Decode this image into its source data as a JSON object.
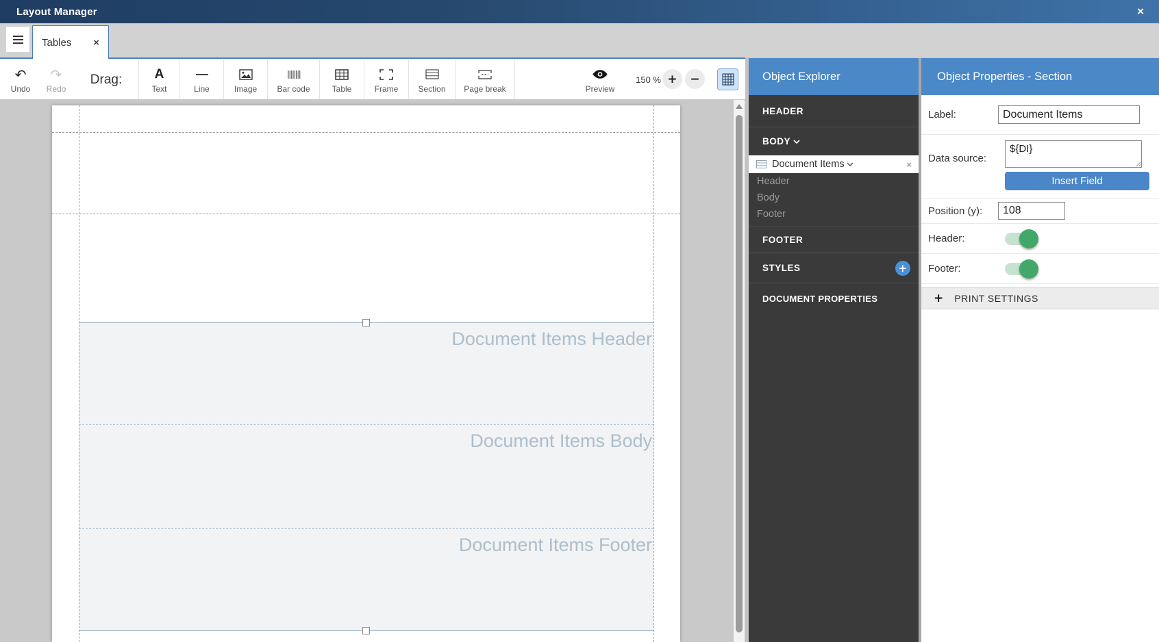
{
  "window": {
    "title": "Layout Manager",
    "close_icon": "×"
  },
  "tabs": {
    "menu_icon": "hamburger",
    "items": [
      {
        "label": "Tables",
        "close_icon": "×",
        "active": true
      }
    ]
  },
  "toolbar": {
    "undo_label": "Undo",
    "redo_label": "Redo",
    "undo_glyph": "↶",
    "redo_glyph": "↷",
    "drag_label": "Drag:",
    "drag_items": [
      {
        "label": "Text",
        "icon": "text-A-icon",
        "glyph": "A"
      },
      {
        "label": "Line",
        "icon": "line-icon"
      },
      {
        "label": "Image",
        "icon": "image-icon"
      },
      {
        "label": "Bar code",
        "icon": "barcode-icon"
      },
      {
        "label": "Table",
        "icon": "table-icon"
      },
      {
        "label": "Frame",
        "icon": "frame-icon"
      },
      {
        "label": "Section",
        "icon": "section-icon"
      },
      {
        "label": "Page break",
        "icon": "page-break-icon"
      }
    ],
    "preview_label": "Preview",
    "preview_icon": "eye-icon",
    "zoom_level": "150 %",
    "zoom_in_glyph": "+",
    "zoom_out_glyph": "−",
    "grid_toggle_icon": "grid-icon"
  },
  "canvas": {
    "sections": [
      {
        "label": "Document Items Header"
      },
      {
        "label": "Document Items Body"
      },
      {
        "label": "Document Items Footer"
      }
    ]
  },
  "object_explorer": {
    "title": "Object Explorer",
    "groups": {
      "header": "HEADER",
      "body": "BODY",
      "footer": "FOOTER",
      "styles": "STYLES",
      "document_properties": "DOCUMENT PROPERTIES"
    },
    "selected_item": {
      "label": "Document Items",
      "icon": "section-rows-icon",
      "delete_icon": "×",
      "children": [
        "Header",
        "Body",
        "Footer"
      ]
    },
    "add_style_glyph": "+"
  },
  "object_properties": {
    "title": "Object Properties - Section",
    "label_field": {
      "name": "Label:",
      "value": "Document Items"
    },
    "data_source": {
      "name": "Data source:",
      "value": "${DI}",
      "button_label": "Insert Field"
    },
    "position_y": {
      "name": "Position (y):",
      "value": "108"
    },
    "header_toggle": {
      "name": "Header:",
      "on": true
    },
    "footer_toggle": {
      "name": "Footer:",
      "on": true
    },
    "print_settings": {
      "expand_icon": "+",
      "label": "PRINT SETTINGS"
    }
  },
  "colors": {
    "titlebar_gradient_start": "#1f3d63",
    "titlebar_gradient_end": "#3f73a9",
    "panel_header_blue": "#4a88c8",
    "accent_button_blue": "#4a86c8",
    "explorer_dark": "#3a3a3a",
    "toggle_on_green": "#41a869",
    "toggle_track_green": "#c6e3cf",
    "section_fill": "#f1f3f5",
    "section_label_text": "#adbecb",
    "section_border_blue": "#9db5cb",
    "canvas_gray": "#c9c9c9"
  }
}
